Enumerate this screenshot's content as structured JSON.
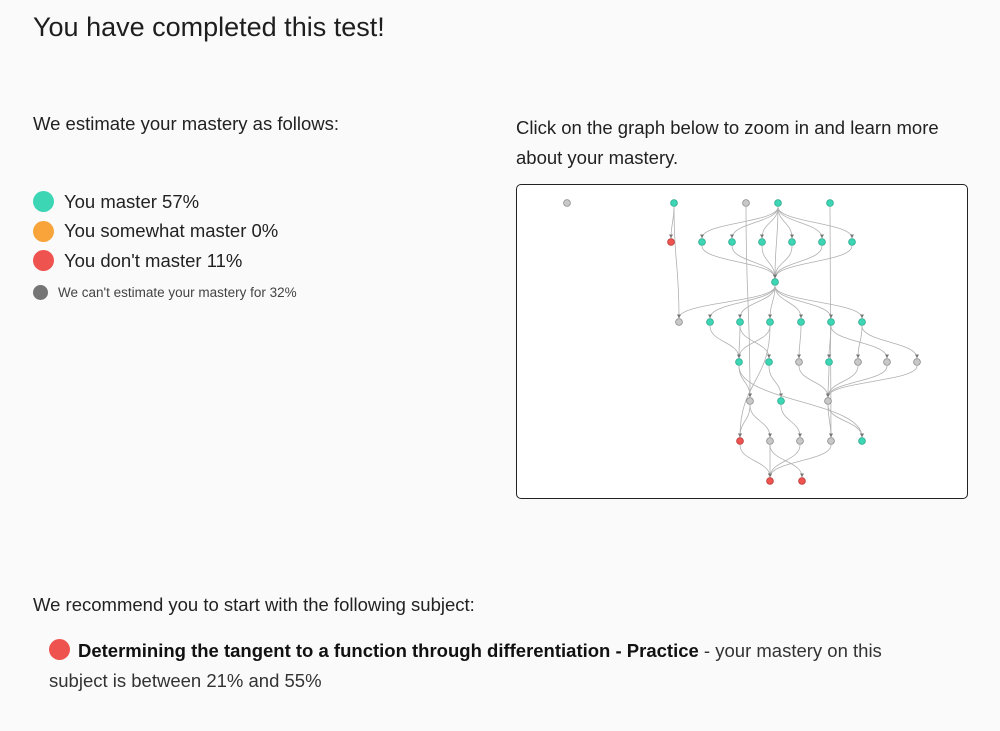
{
  "page": {
    "title": "You have completed this test!",
    "intro": "We estimate your mastery as follows:",
    "graph_hint": "Click on the graph below to zoom in and learn more about your mastery.",
    "recommend_intro": "We recommend you to start with the following subject:"
  },
  "colors": {
    "master": "#3dd6b5",
    "somewhat": "#f8a43a",
    "not_master": "#ef5350",
    "unknown": "#757575"
  },
  "legend": {
    "master": "You master 57%",
    "somewhat": "You somewhat master 0%",
    "not_master": "You don't master 11%",
    "unknown": "We can't estimate your mastery for 32%"
  },
  "recommendation": {
    "status": "not_master",
    "subject": "Determining the tangent to a function through differentiation - Practice",
    "detail_prefix": " - your mastery on this",
    "detail_suffix": "subject is between 21% and 55%"
  },
  "graph": {
    "node_states": [
      "u",
      "m",
      "u",
      "m",
      "m",
      "r",
      "m",
      "m",
      "m",
      "m",
      "m",
      "m",
      "m",
      "u",
      "m",
      "m",
      "m",
      "m",
      "m",
      "m",
      "m",
      "m",
      "u",
      "m",
      "u",
      "u",
      "u",
      "u",
      "m",
      "u",
      "r",
      "u",
      "u",
      "u",
      "m",
      "r",
      "r"
    ]
  }
}
